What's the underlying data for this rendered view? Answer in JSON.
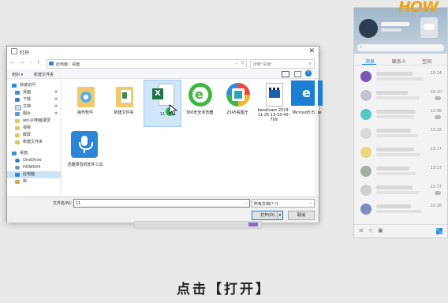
{
  "dialog": {
    "title": "打开",
    "address": "此电脑 › 桌面",
    "search_placeholder": "搜索\"桌面\"",
    "toolbar": {
      "organize": "组织 ▾",
      "new_folder": "新建文件夹"
    },
    "nav": [
      {
        "label": "快速访问",
        "pin": ""
      },
      {
        "label": "桌面",
        "pin": "✱"
      },
      {
        "label": "下载",
        "pin": "✱"
      },
      {
        "label": "文档",
        "pin": "✱"
      },
      {
        "label": "图片",
        "pin": "✱"
      },
      {
        "label": "win10电脑录屏",
        "pin": ""
      },
      {
        "label": "视频",
        "pin": ""
      },
      {
        "label": "截屏",
        "pin": ""
      },
      {
        "label": "新建文件夹",
        "pin": ""
      },
      {
        "label": "桌面",
        "pin": ""
      },
      {
        "label": "OneDrive",
        "pin": ""
      },
      {
        "label": "HOW004",
        "pin": ""
      },
      {
        "label": "此电脑",
        "pin": ""
      },
      {
        "label": "库",
        "pin": ""
      }
    ],
    "files": [
      {
        "name": "操作软件",
        "icon": "folder-ie-icon"
      },
      {
        "name": "新建文件夹",
        "icon": "folder-docs-icon"
      },
      {
        "name": "11",
        "icon": "excel-icon"
      },
      {
        "name": "360安全浏览器",
        "icon": "browser-360-icon"
      },
      {
        "name": "2345看图王",
        "icon": "image-viewer-icon"
      },
      {
        "name": "bandicam 2019-11-25 13-33-40-799",
        "icon": "video-file-icon"
      },
      {
        "name": "Microsoft Edge",
        "icon": "edge-icon"
      },
      {
        "name": "迅捷录音机软件工具",
        "icon": "microphone-icon"
      }
    ],
    "filename_label": "文件名(N):",
    "filename_value": "11",
    "filetype_value": "所有文档(*.*)",
    "open_button": "打开(O)",
    "cancel_button": "取消"
  },
  "chat": {
    "tabs": [
      "消息",
      "联系人",
      "空间"
    ],
    "times": [
      "10:24",
      "10:10",
      "13:36",
      "13:32",
      "13:17",
      "13:17",
      "11:37",
      "10:26"
    ]
  },
  "watermark": "HOW",
  "caption": "点击【打开】",
  "colors": {
    "accent": "#1e7fd6",
    "excel": "#1f7244",
    "edge": "#1b7ed4",
    "mic": "#2b86d8"
  }
}
